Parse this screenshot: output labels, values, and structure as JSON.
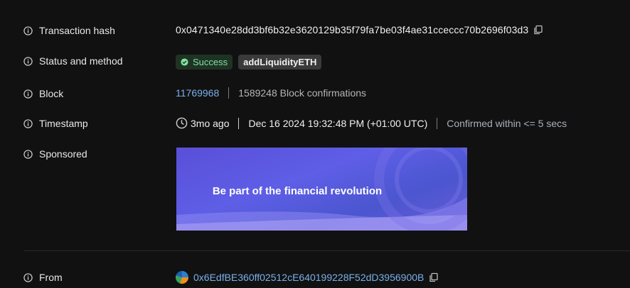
{
  "rows": {
    "tx_hash": {
      "label": "Transaction hash",
      "value": "0x0471340e28dd3bf6b32e3620129b35f79fa7be03f4ae31cceccc70b2696f03d3"
    },
    "status": {
      "label": "Status and method",
      "status": "Success",
      "method": "addLiquidityETH"
    },
    "block": {
      "label": "Block",
      "number": "11769968",
      "confirmations": "1589248 Block confirmations"
    },
    "timestamp": {
      "label": "Timestamp",
      "relative": "3mo ago",
      "absolute": "Dec 16 2024 19:32:48 PM (+01:00 UTC)",
      "confirmed": "Confirmed within <= 5 secs"
    },
    "sponsored": {
      "label": "Sponsored",
      "banner_text": "Be part of the financial revolution"
    },
    "from": {
      "label": "From",
      "address": "0x6EdfBE360ff02512cE640199228F52dD3956900B"
    }
  },
  "colors": {
    "link": "#7ab0ea",
    "success": "#7fe3a0",
    "background": "#111111"
  },
  "icons": [
    "info-icon",
    "copy-icon",
    "check-circle-icon",
    "clock-icon"
  ]
}
